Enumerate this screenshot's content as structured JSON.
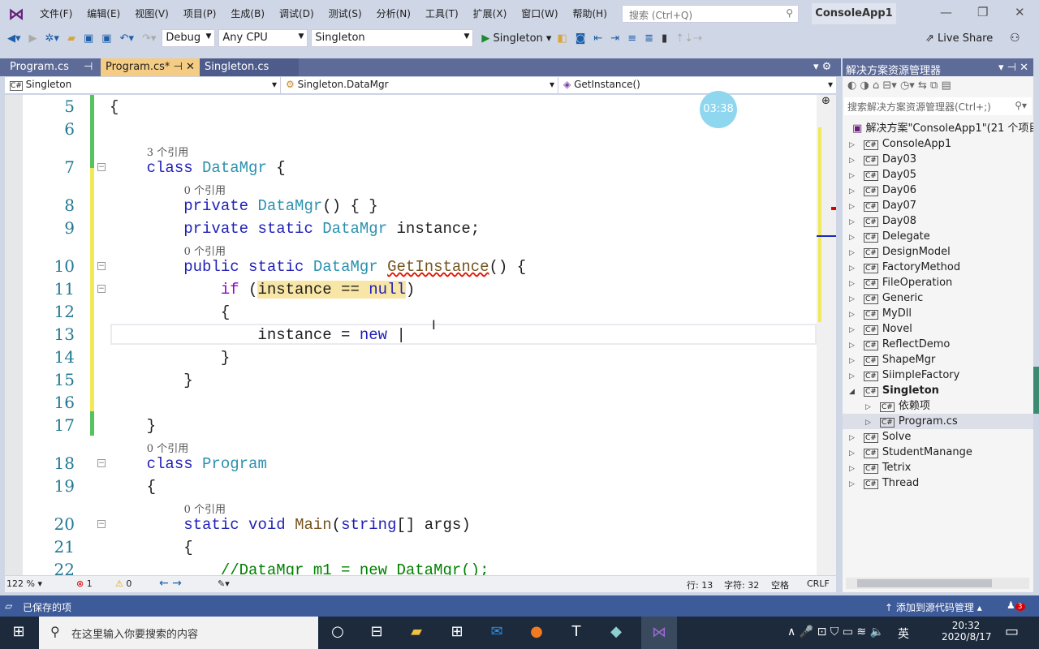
{
  "menu": [
    "文件(F)",
    "编辑(E)",
    "视图(V)",
    "项目(P)",
    "生成(B)",
    "调试(D)",
    "测试(S)",
    "分析(N)",
    "工具(T)",
    "扩展(X)",
    "窗口(W)",
    "帮助(H)"
  ],
  "search_placeholder": "搜索 (Ctrl+Q)",
  "app_name": "ConsoleApp1",
  "toolbar": {
    "config": "Debug",
    "platform": "Any CPU",
    "startup": "Singleton",
    "run": "Singleton",
    "live_share": "Live Share"
  },
  "tabs": [
    {
      "label": "Program.cs",
      "pin": "⊣"
    },
    {
      "label": "Program.cs*",
      "pin": "⊣",
      "close": "✕"
    },
    {
      "label": "Singleton.cs"
    }
  ],
  "navbar": {
    "project": "Singleton",
    "class": "Singleton.DataMgr",
    "member": "GetInstance()"
  },
  "timer": "03:38",
  "code": [
    {
      "n": "5",
      "k": "code",
      "tokens": [
        [
          "{",
          "tx"
        ]
      ]
    },
    {
      "n": "6",
      "k": "code",
      "tokens": []
    },
    {
      "k": "ref",
      "indent": 4,
      "text": "3 个引用"
    },
    {
      "n": "7",
      "k": "code",
      "tokens": [
        [
          "    ",
          ""
        ],
        [
          "class",
          "kw"
        ],
        [
          " ",
          ""
        ],
        [
          "DataMgr",
          "ty"
        ],
        [
          " {",
          "tx"
        ]
      ]
    },
    {
      "k": "ref",
      "indent": 8,
      "text": "0 个引用"
    },
    {
      "n": "8",
      "k": "code",
      "tokens": [
        [
          "        ",
          ""
        ],
        [
          "private",
          "kw"
        ],
        [
          " ",
          ""
        ],
        [
          "DataMgr",
          "ty"
        ],
        [
          "() { }",
          "tx"
        ]
      ]
    },
    {
      "n": "9",
      "k": "code",
      "tokens": [
        [
          "        ",
          ""
        ],
        [
          "private",
          "kw"
        ],
        [
          " ",
          ""
        ],
        [
          "static",
          "kw"
        ],
        [
          " ",
          ""
        ],
        [
          "DataMgr",
          "ty"
        ],
        [
          " instance;",
          "tx"
        ]
      ]
    },
    {
      "k": "ref",
      "indent": 8,
      "text": "0 个引用"
    },
    {
      "n": "10",
      "k": "code",
      "tokens": [
        [
          "        ",
          ""
        ],
        [
          "public",
          "kw"
        ],
        [
          " ",
          ""
        ],
        [
          "static",
          "kw"
        ],
        [
          " ",
          ""
        ],
        [
          "DataMgr",
          "ty"
        ],
        [
          " ",
          ""
        ],
        [
          "GetInstance",
          "fn squig"
        ],
        [
          "() {",
          "tx"
        ]
      ]
    },
    {
      "n": "11",
      "k": "code",
      "tokens": [
        [
          "            ",
          ""
        ],
        [
          "if",
          "ctl"
        ],
        [
          " (",
          "tx"
        ],
        [
          "instance == ",
          "tx hl"
        ],
        [
          "null",
          "kw hl"
        ],
        [
          ")",
          "tx"
        ]
      ]
    },
    {
      "n": "12",
      "k": "code",
      "tokens": [
        [
          "            {",
          "tx"
        ]
      ]
    },
    {
      "n": "13",
      "k": "code",
      "tokens": [
        [
          "                instance = ",
          "tx"
        ],
        [
          "new",
          "kw"
        ],
        [
          " |",
          "tx"
        ]
      ]
    },
    {
      "n": "14",
      "k": "code",
      "tokens": [
        [
          "            }",
          "tx"
        ]
      ]
    },
    {
      "n": "15",
      "k": "code",
      "tokens": [
        [
          "        }",
          "tx"
        ]
      ]
    },
    {
      "n": "16",
      "k": "code",
      "tokens": []
    },
    {
      "n": "17",
      "k": "code",
      "tokens": [
        [
          "    }",
          "tx"
        ]
      ]
    },
    {
      "k": "ref",
      "indent": 4,
      "text": "0 个引用"
    },
    {
      "n": "18",
      "k": "code",
      "tokens": [
        [
          "    ",
          ""
        ],
        [
          "class",
          "kw"
        ],
        [
          " ",
          ""
        ],
        [
          "Program",
          "ty"
        ]
      ]
    },
    {
      "n": "19",
      "k": "code",
      "tokens": [
        [
          "    {",
          "tx"
        ]
      ]
    },
    {
      "k": "ref",
      "indent": 8,
      "text": "0 个引用"
    },
    {
      "n": "20",
      "k": "code",
      "tokens": [
        [
          "        ",
          ""
        ],
        [
          "static",
          "kw"
        ],
        [
          " ",
          ""
        ],
        [
          "void",
          "kw"
        ],
        [
          " ",
          ""
        ],
        [
          "Main",
          "fn"
        ],
        [
          "(",
          "tx"
        ],
        [
          "string",
          "kw"
        ],
        [
          "[] args)",
          "tx"
        ]
      ]
    },
    {
      "n": "21",
      "k": "code",
      "tokens": [
        [
          "        {",
          "tx"
        ]
      ]
    },
    {
      "n": "22",
      "k": "code",
      "tokens": [
        [
          "            //DataMgr m1 = new DataMgr();",
          "cm"
        ]
      ]
    }
  ],
  "editor_status": {
    "zoom": "122 %",
    "errors": "1",
    "warnings": "0",
    "line": "行: 13",
    "col": "字符: 32",
    "spaces": "空格",
    "eol": "CRLF"
  },
  "solution": {
    "title": "解决方案资源管理器",
    "search_placeholder": "搜索解决方案资源管理器(Ctrl+;)",
    "root": "解决方案\"ConsoleApp1\"(21 个项目,",
    "items": [
      {
        "label": "ConsoleApp1",
        "lvl": 0
      },
      {
        "label": "Day03",
        "lvl": 0
      },
      {
        "label": "Day05",
        "lvl": 0
      },
      {
        "label": "Day06",
        "lvl": 0
      },
      {
        "label": "Day07",
        "lvl": 0
      },
      {
        "label": "Day08",
        "lvl": 0
      },
      {
        "label": "Delegate",
        "lvl": 0
      },
      {
        "label": "DesignModel",
        "lvl": 0
      },
      {
        "label": "FactoryMethod",
        "lvl": 0
      },
      {
        "label": "FileOperation",
        "lvl": 0
      },
      {
        "label": "Generic",
        "lvl": 0
      },
      {
        "label": "MyDll",
        "lvl": 0
      },
      {
        "label": "Novel",
        "lvl": 0
      },
      {
        "label": "ReflectDemo",
        "lvl": 0
      },
      {
        "label": "ShapeMgr",
        "lvl": 0
      },
      {
        "label": "SiimpleFactory",
        "lvl": 0
      },
      {
        "label": "Singleton",
        "lvl": 0,
        "open": true,
        "bold": true
      },
      {
        "label": "依赖项",
        "lvl": 1
      },
      {
        "label": "Program.cs",
        "lvl": 1,
        "sel": true
      },
      {
        "label": "Solve",
        "lvl": 0
      },
      {
        "label": "StudentManange",
        "lvl": 0
      },
      {
        "label": "Tetrix",
        "lvl": 0
      },
      {
        "label": "Thread",
        "lvl": 0
      }
    ]
  },
  "statusbar": {
    "left": "已保存的项",
    "right": "添加到源代码管理",
    "notifications": "3"
  },
  "taskbar": {
    "search": "在这里输入你要搜索的内容",
    "ime": "英",
    "time": "20:32",
    "date": "2020/8/17"
  },
  "colors": {
    "accent": "#68217a",
    "tab_active": "#f5cc84",
    "tab_bar": "#5d6b99",
    "status": "#3d5a99"
  }
}
